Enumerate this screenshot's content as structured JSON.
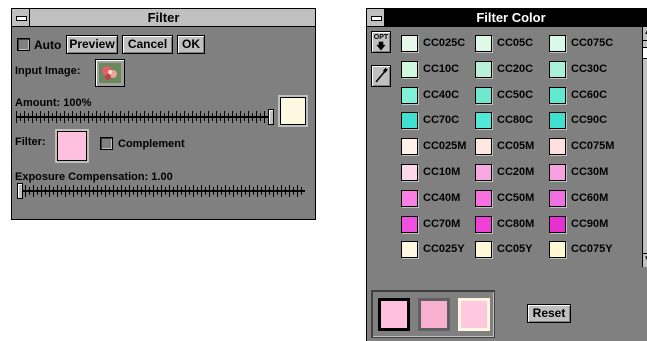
{
  "filter_window": {
    "title": "Filter",
    "auto_label": "Auto",
    "preview_label": "Preview",
    "cancel_label": "Cancel",
    "ok_label": "OK",
    "input_image_label": "Input Image:",
    "amount_label": "Amount: 100%",
    "amount_value_fraction": 1.0,
    "filter_label": "Filter:",
    "complement_label": "Complement",
    "exposure_label": "Exposure Compensation: 1.00",
    "exposure_value_fraction": 0.0,
    "filter_color": "#ffc0e0",
    "amount_color": "#fff8e0"
  },
  "filter_color_window": {
    "title": "Filter Color",
    "opt_label": "OPT",
    "reset_label": "Reset",
    "filters": [
      {
        "name": "CC025C",
        "color": "#e8f8e8"
      },
      {
        "name": "CC05C",
        "color": "#e0f8e8"
      },
      {
        "name": "CC075C",
        "color": "#d8f8e8"
      },
      {
        "name": "CC10C",
        "color": "#d0f8e0"
      },
      {
        "name": "CC20C",
        "color": "#b8f0d8"
      },
      {
        "name": "CC30C",
        "color": "#a8f0d8"
      },
      {
        "name": "CC40C",
        "color": "#80f0d8"
      },
      {
        "name": "CC50C",
        "color": "#70e8d0"
      },
      {
        "name": "CC60C",
        "color": "#60e8d0"
      },
      {
        "name": "CC70C",
        "color": "#40e0d0"
      },
      {
        "name": "CC80C",
        "color": "#50e8d8"
      },
      {
        "name": "CC90C",
        "color": "#40e0d0"
      },
      {
        "name": "CC025M",
        "color": "#fff0e8"
      },
      {
        "name": "CC05M",
        "color": "#ffe8e0"
      },
      {
        "name": "CC075M",
        "color": "#ffe0e0"
      },
      {
        "name": "CC10M",
        "color": "#ffd8e8"
      },
      {
        "name": "CC20M",
        "color": "#f8a8e0"
      },
      {
        "name": "CC30M",
        "color": "#f8a0e0"
      },
      {
        "name": "CC40M",
        "color": "#f880e0"
      },
      {
        "name": "CC50M",
        "color": "#f870e0"
      },
      {
        "name": "CC60M",
        "color": "#f070e0"
      },
      {
        "name": "CC70M",
        "color": "#f050e0"
      },
      {
        "name": "CC80M",
        "color": "#f040d8"
      },
      {
        "name": "CC90M",
        "color": "#e830d0"
      },
      {
        "name": "CC025Y",
        "color": "#fff8e0"
      },
      {
        "name": "CC05Y",
        "color": "#fff8d8"
      },
      {
        "name": "CC075Y",
        "color": "#fff8d0"
      }
    ],
    "selected_colors": [
      "#ffc0e0",
      "#f8b0d0",
      "#ffc8e0"
    ]
  }
}
